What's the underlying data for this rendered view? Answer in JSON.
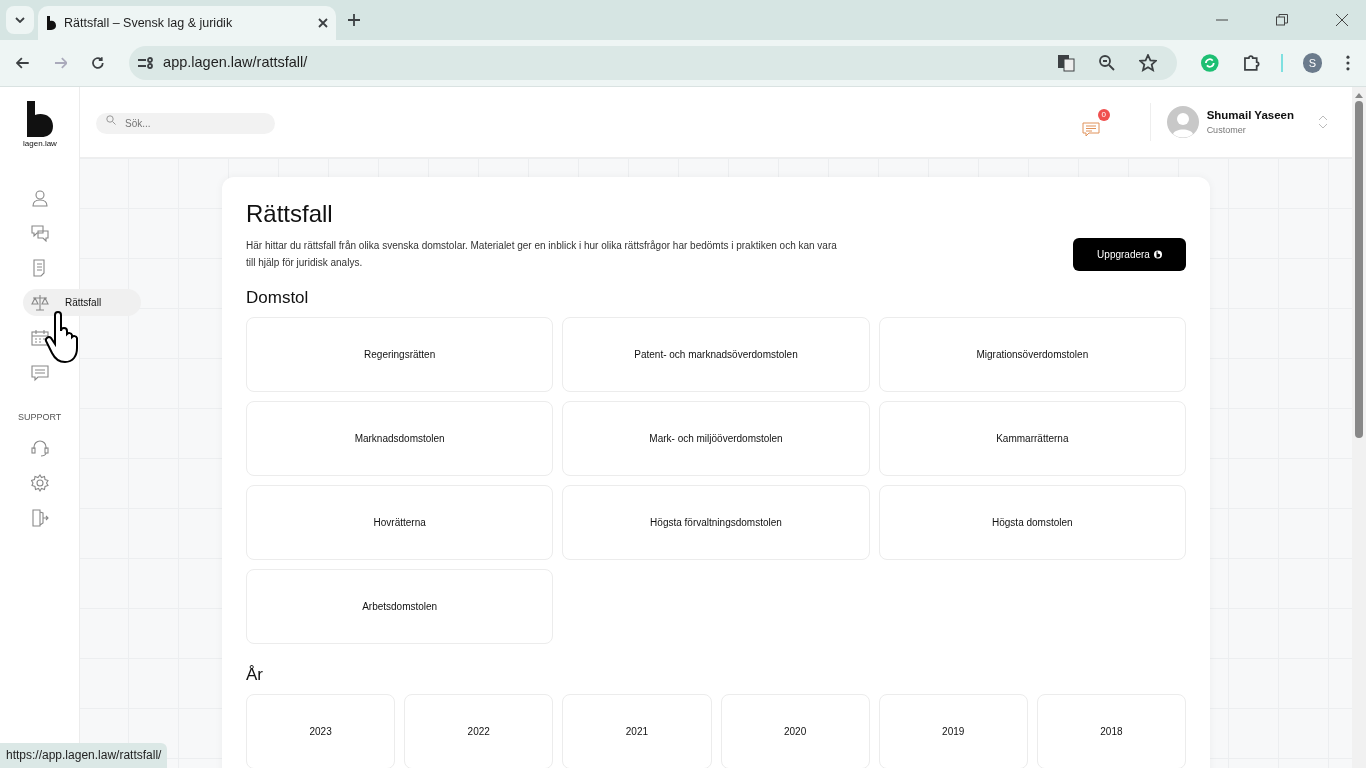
{
  "browser": {
    "tab_title": "Rättsfall – Svensk lag & juridik",
    "url": "app.lagen.law/rattsfall/",
    "profile_initial": "S",
    "status_url": "https://app.lagen.law/rattsfall/"
  },
  "sidebar": {
    "logo_text": "lagen.law",
    "items": [
      {
        "selected": false
      },
      {
        "selected": false
      },
      {
        "selected": false
      },
      {
        "selected": true,
        "label": "Rättsfall"
      },
      {
        "selected": false
      },
      {
        "selected": false
      }
    ],
    "support_label": "SUPPORT"
  },
  "header": {
    "search": {
      "placeholder": "Sök..."
    },
    "notification_count": "0",
    "user": {
      "name": "Shumail Yaseen",
      "role": "Customer"
    }
  },
  "page": {
    "title": "Rättsfall",
    "description": "Här hittar du rättsfall från olika svenska domstolar. Materialet ger en inblick i hur olika rättsfrågor har bedömts i praktiken och kan vara till hjälp för juridisk analys.",
    "upgrade_button": "Uppgradera",
    "sections": [
      {
        "kind": "courts",
        "heading": "Domstol",
        "items": [
          "Regeringsrätten",
          "Patent- och marknadsöverdomstolen",
          "Migrationsöverdomstolen",
          "Marknadsdomstolen",
          "Mark- och miljööverdomstolen",
          "Kammarrätterna",
          "Hovrätterna",
          "Högsta förvaltningsdomstolen",
          "Högsta domstolen",
          "Arbetsdomstolen"
        ]
      },
      {
        "kind": "years",
        "heading": "År",
        "items": [
          "2023",
          "2022",
          "2021",
          "2020",
          "2019",
          "2018"
        ]
      }
    ]
  }
}
